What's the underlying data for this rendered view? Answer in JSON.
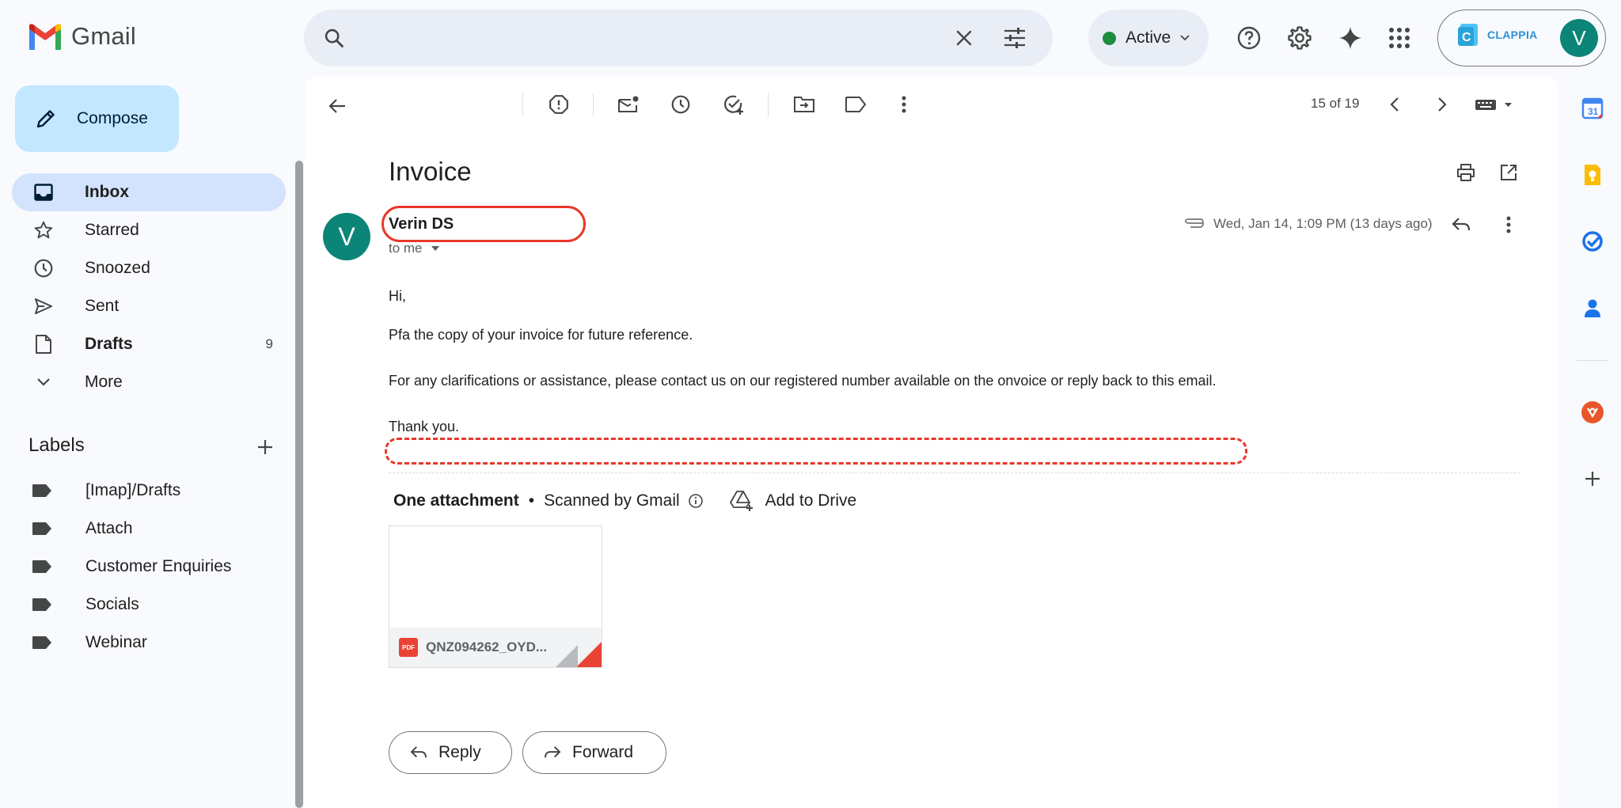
{
  "app": {
    "name": "Gmail"
  },
  "status": {
    "label": "Active"
  },
  "account": {
    "brand": "CLAPPIA",
    "avatar_initial": "V"
  },
  "sidebar": {
    "compose_label": "Compose",
    "items": [
      {
        "label": "Inbox",
        "icon": "inbox-icon",
        "active": true
      },
      {
        "label": "Starred",
        "icon": "star-icon"
      },
      {
        "label": "Snoozed",
        "icon": "clock-icon"
      },
      {
        "label": "Sent",
        "icon": "send-icon"
      },
      {
        "label": "Drafts",
        "icon": "draft-icon",
        "count": "9"
      },
      {
        "label": "More",
        "icon": "chevron-down-icon"
      }
    ],
    "labels_title": "Labels",
    "labels": [
      "[Imap]/Drafts",
      "Attach",
      "Customer Enquiries",
      "Socials",
      "Webinar"
    ]
  },
  "toolbar": {
    "counter": "15 of 19"
  },
  "email": {
    "subject": "Invoice",
    "sender_initial": "V",
    "sender_name": "Verin DS",
    "recipient": "to me",
    "date": "Wed, Jan 14, 1:09 PM (13 days ago)",
    "body": [
      "Hi,",
      "Pfa the copy of your invoice for future reference.",
      "For any clarifications or assistance, please contact us on our registered number available on the onvoice or reply back to this email.",
      "Thank you."
    ],
    "attachments_title": "One attachment",
    "scan_note": "Scanned by Gmail",
    "add_to_drive": "Add to Drive",
    "attachment_name": "QNZ094262_OYD...",
    "attachment_type": "PDF",
    "reply_label": "Reply",
    "forward_label": "Forward"
  },
  "colors": {
    "accent": "#0b57d0",
    "highlight": "#e8382a",
    "avatar": "#0b8577",
    "compose": "#c2e7ff"
  }
}
